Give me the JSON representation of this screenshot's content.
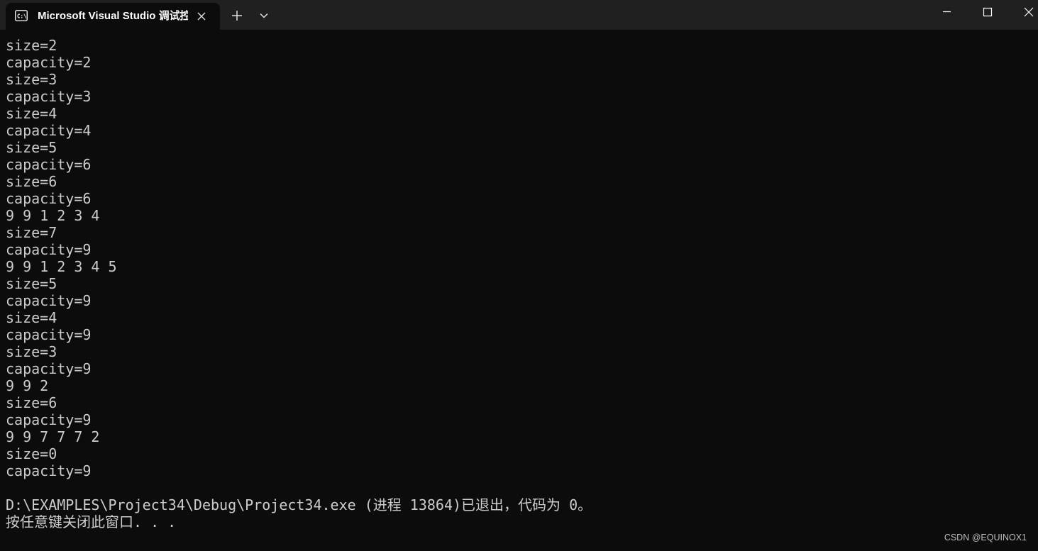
{
  "window": {
    "tab_title": "Microsoft Visual Studio 调试控制台",
    "icons": {
      "tab_icon": "terminal-icon",
      "tab_close": "close-icon",
      "new_tab": "plus-icon",
      "dropdown": "chevron-down-icon",
      "minimize": "minimize-icon",
      "maximize": "maximize-icon",
      "close": "close-icon"
    }
  },
  "console": {
    "lines": [
      "size=2",
      "capacity=2",
      "size=3",
      "capacity=3",
      "size=4",
      "capacity=4",
      "size=5",
      "capacity=6",
      "size=6",
      "capacity=6",
      "9 9 1 2 3 4",
      "size=7",
      "capacity=9",
      "9 9 1 2 3 4 5",
      "size=5",
      "capacity=9",
      "size=4",
      "capacity=9",
      "size=3",
      "capacity=9",
      "9 9 2",
      "size=6",
      "capacity=9",
      "9 9 7 7 7 2",
      "size=0",
      "capacity=9",
      "",
      "D:\\EXAMPLES\\Project34\\Debug\\Project34.exe (进程 13864)已退出，代码为 0。",
      "按任意键关闭此窗口. . ."
    ]
  },
  "watermark": "CSDN @EQUINOX1",
  "colors": {
    "background": "#0c0c0c",
    "titlebar": "#202020",
    "text": "#cccccc"
  }
}
